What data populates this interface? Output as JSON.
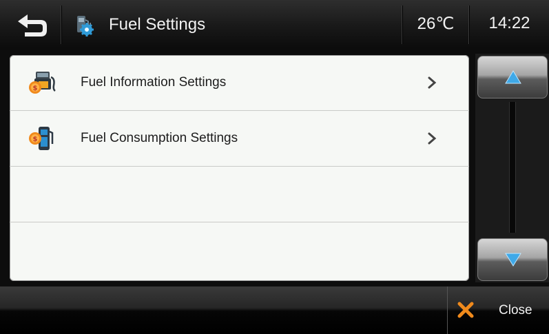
{
  "header": {
    "title": "Fuel Settings",
    "temperature": "26℃",
    "time": "14:22"
  },
  "menu": {
    "items": [
      {
        "label": "Fuel Information Settings",
        "icon": "fuel-information-icon"
      },
      {
        "label": "Fuel Consumption Settings",
        "icon": "fuel-pump-icon"
      }
    ]
  },
  "footer": {
    "close_label": "Close"
  },
  "colors": {
    "accent_blue": "#3fa9e8",
    "close_orange": "#f08a1c",
    "panel_bg": "#f6f8f5"
  }
}
